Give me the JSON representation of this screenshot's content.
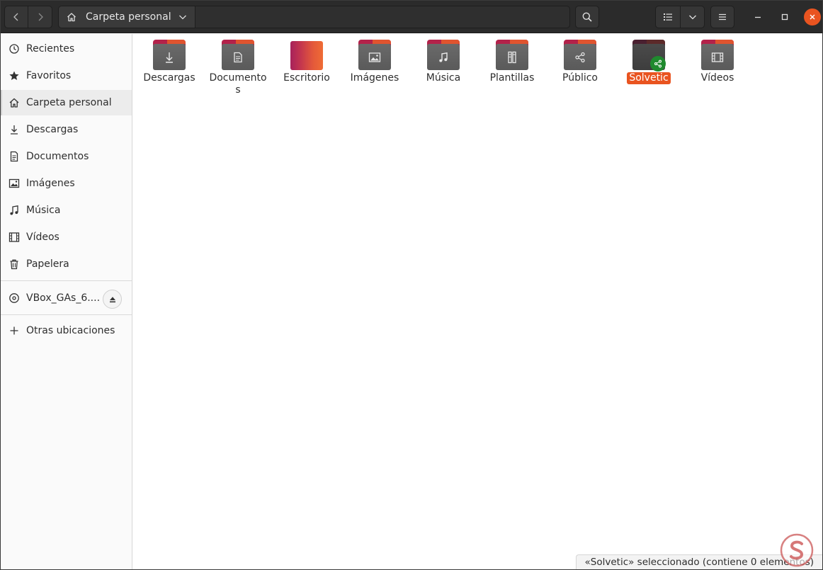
{
  "window": {
    "title": "Carpeta personal"
  },
  "header": {
    "path_label": "Carpeta personal",
    "icons": {
      "back": "go-back-icon",
      "forward": "go-forward-icon",
      "home": "home-icon",
      "path_dropdown": "chevron-down-icon",
      "search": "search-icon",
      "view": "list-view-icon",
      "view_options": "chevron-down-icon",
      "menu": "hamburger-menu-icon",
      "minimize": "minimize-icon",
      "maximize": "maximize-icon",
      "close": "close-icon"
    }
  },
  "sidebar": {
    "items": [
      {
        "label": "Recientes",
        "icon": "clock-icon"
      },
      {
        "label": "Favoritos",
        "icon": "star-icon"
      },
      {
        "label": "Carpeta personal",
        "icon": "home-icon",
        "active": true
      },
      {
        "label": "Descargas",
        "icon": "download-icon"
      },
      {
        "label": "Documentos",
        "icon": "document-icon"
      },
      {
        "label": "Imágenes",
        "icon": "image-icon"
      },
      {
        "label": "Música",
        "icon": "music-icon"
      },
      {
        "label": "Vídeos",
        "icon": "film-icon"
      },
      {
        "label": "Papelera",
        "icon": "trash-icon"
      }
    ],
    "devices": [
      {
        "label": "VBox_GAs_6....",
        "icon": "disc-icon",
        "action_icon": "eject-icon"
      }
    ],
    "other": {
      "label": "Otras ubicaciones",
      "icon": "plus-icon"
    }
  },
  "files": [
    {
      "name": "Descargas",
      "emblem": "download-icon"
    },
    {
      "name": "Documentos",
      "emblem": "document-icon"
    },
    {
      "name": "Escritorio",
      "emblem": ""
    },
    {
      "name": "Imágenes",
      "emblem": "image-icon"
    },
    {
      "name": "Música",
      "emblem": "music-icon"
    },
    {
      "name": "Plantillas",
      "emblem": "template-icon"
    },
    {
      "name": "Público",
      "emblem": "share-icon"
    },
    {
      "name": "Solvetic",
      "emblem": "",
      "selected": true,
      "shared_emblem": "share-icon"
    },
    {
      "name": "Vídeos",
      "emblem": "film-icon"
    }
  ],
  "status": {
    "text": "«Solvetic» seleccionado  (contiene 0 elementos)"
  },
  "colors": {
    "accent": "#e95420",
    "headerbar": "#2b2b2b",
    "folder_tab": "#b3224a",
    "folder_body": "#5f5f5f",
    "share_emblem": "#1f8a2e"
  }
}
